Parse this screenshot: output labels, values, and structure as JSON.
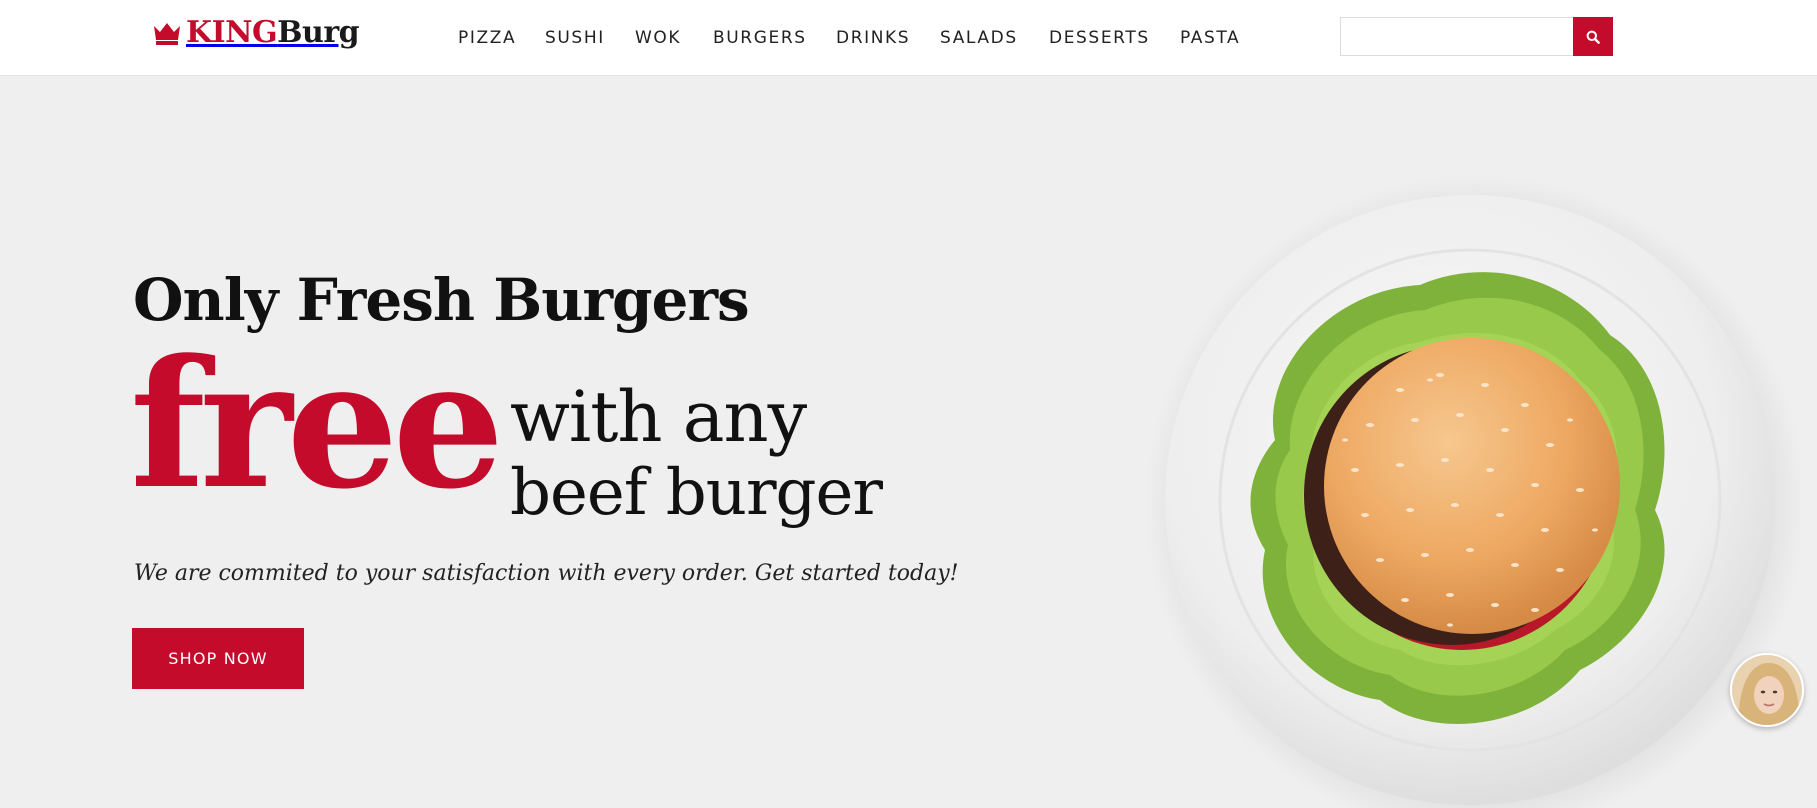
{
  "brand": {
    "part1": "KING",
    "part2": "Burg",
    "color": "#c40b2c"
  },
  "nav": {
    "items": [
      "PIZZA",
      "SUSHI",
      "WOK",
      "BURGERS",
      "DRINKS",
      "SALADS",
      "DESSERTS",
      "PASTA"
    ]
  },
  "search": {
    "value": "",
    "placeholder": "",
    "icon": "search-icon"
  },
  "hero": {
    "subtitle": "Only Fresh Burgers",
    "highlight": "free",
    "line1": "with any",
    "line2": "beef burger",
    "tagline": "We are commited to your satisfaction with every order. Get started today!",
    "cta": "SHOP NOW"
  },
  "colors": {
    "accent": "#c40b2c",
    "background": "#efefef",
    "header": "#ffffff"
  }
}
